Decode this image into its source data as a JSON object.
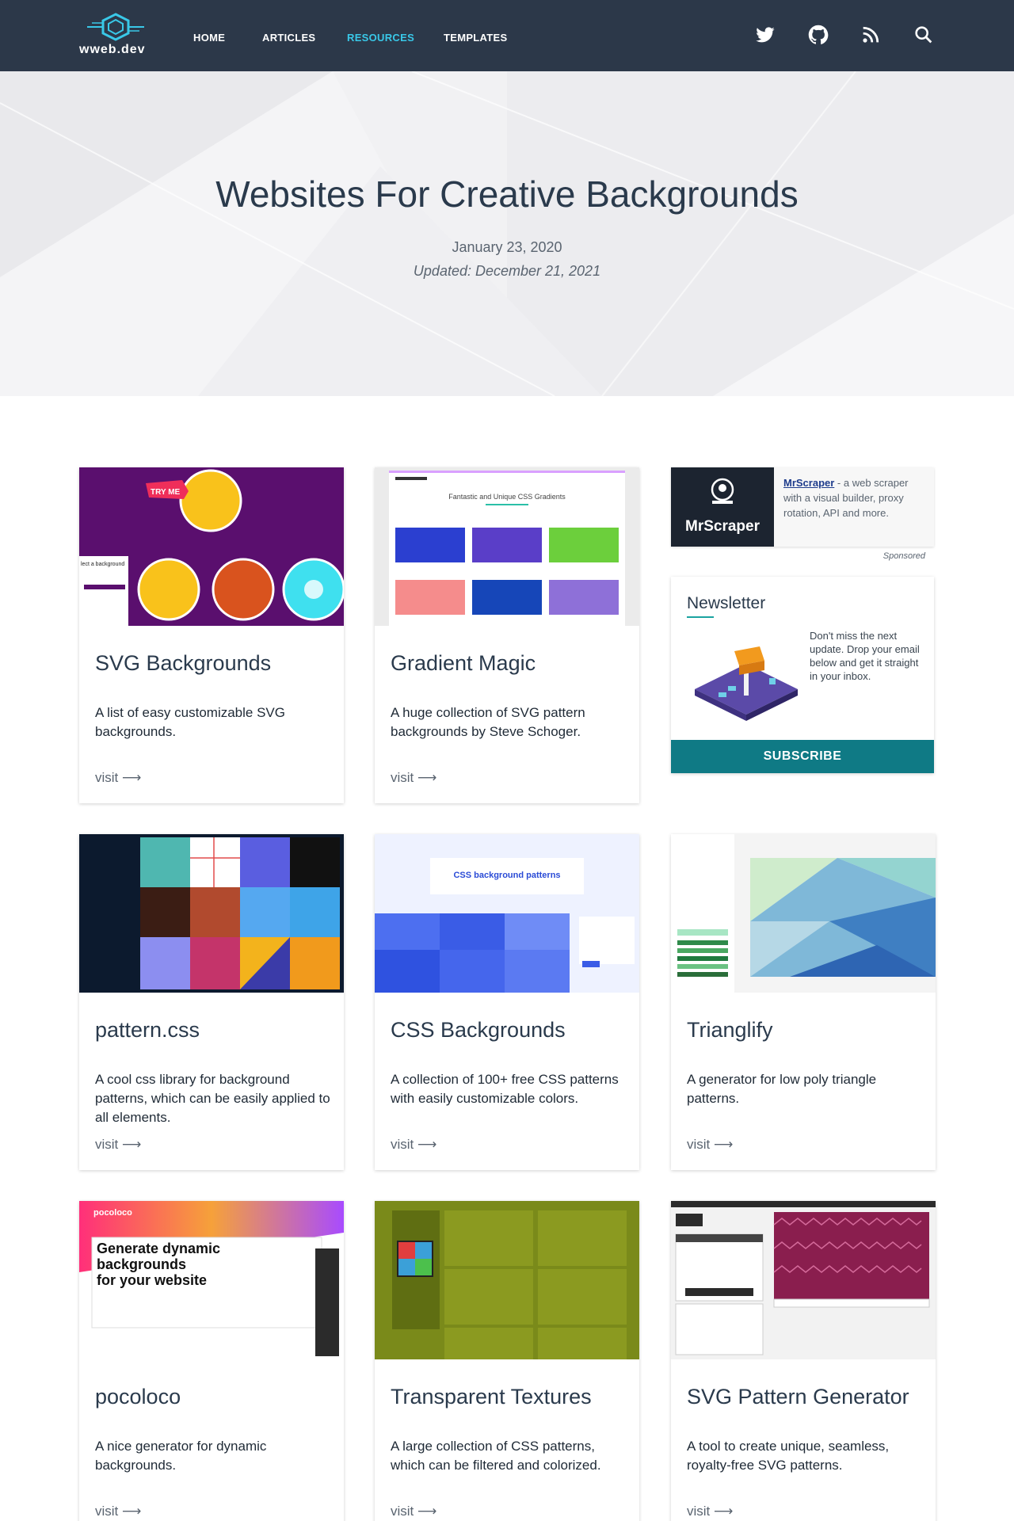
{
  "nav": {
    "logo_text": "wweb.dev",
    "links": [
      {
        "label": "HOME",
        "active": false
      },
      {
        "label": "ARTICLES",
        "active": false
      },
      {
        "label": "RESOURCES",
        "active": true
      },
      {
        "label": "TEMPLATES",
        "active": false
      }
    ],
    "icons": [
      "twitter-icon",
      "github-icon",
      "rss-icon",
      "search-icon"
    ]
  },
  "hero": {
    "title": "Websites For Creative Backgrounds",
    "date": "January 23, 2020",
    "updated": "Updated: December 21, 2021"
  },
  "cards": [
    {
      "title": "SVG Backgrounds",
      "description": "A list of easy customizable SVG backgrounds.",
      "visit": "visit ⟶"
    },
    {
      "title": "Gradient Magic",
      "description": "A huge collection of SVG pattern backgrounds by Steve Schoger.",
      "visit": "visit ⟶"
    },
    {
      "title": "pattern.css",
      "description": "A cool css library for background patterns, which can be easily applied to all elements.",
      "visit": "visit ⟶"
    },
    {
      "title": "CSS Backgrounds",
      "description": "A collection of 100+ free CSS patterns with easily customizable colors.",
      "visit": "visit ⟶"
    },
    {
      "title": "Trianglify",
      "description": "A generator for low poly triangle patterns.",
      "visit": "visit ⟶"
    },
    {
      "title": "pocoloco",
      "description": "A nice generator for dynamic backgrounds.",
      "visit": "visit ⟶"
    },
    {
      "title": "Transparent Textures",
      "description": "A large collection of CSS patterns, which can be filtered and colorized.",
      "visit": "visit ⟶"
    },
    {
      "title": "SVG Pattern Generator",
      "description": "A tool to create unique, seamless, royalty-free SVG patterns.",
      "visit": "visit ⟶"
    }
  ],
  "thumbnails": {
    "svg_backgrounds": {
      "badge": "TRY ME",
      "caption": "lect a background"
    },
    "gradient_magic": {
      "heading": "Fantastic and Unique CSS Gradients"
    },
    "css_backgrounds": {
      "heading": "CSS background patterns"
    },
    "pocoloco": {
      "brand": "pocoloco",
      "headline_1": "Generate dynamic",
      "headline_2": "backgrounds",
      "headline_3": "for your website"
    }
  },
  "sponsor": {
    "logo_text": "MrScraper",
    "link_text": "MrScraper",
    "text": " - a web scraper with a visual builder, proxy rotation, API and more.",
    "label": "Sponsored"
  },
  "newsletter": {
    "title": "Newsletter",
    "text": "Don't miss the next update. Drop your email below and get it straight in your inbox.",
    "button": "SUBSCRIBE"
  },
  "colors": {
    "nav_bg": "#2c3849",
    "accent": "#39c8e8",
    "subscribe": "#0f7a85"
  }
}
